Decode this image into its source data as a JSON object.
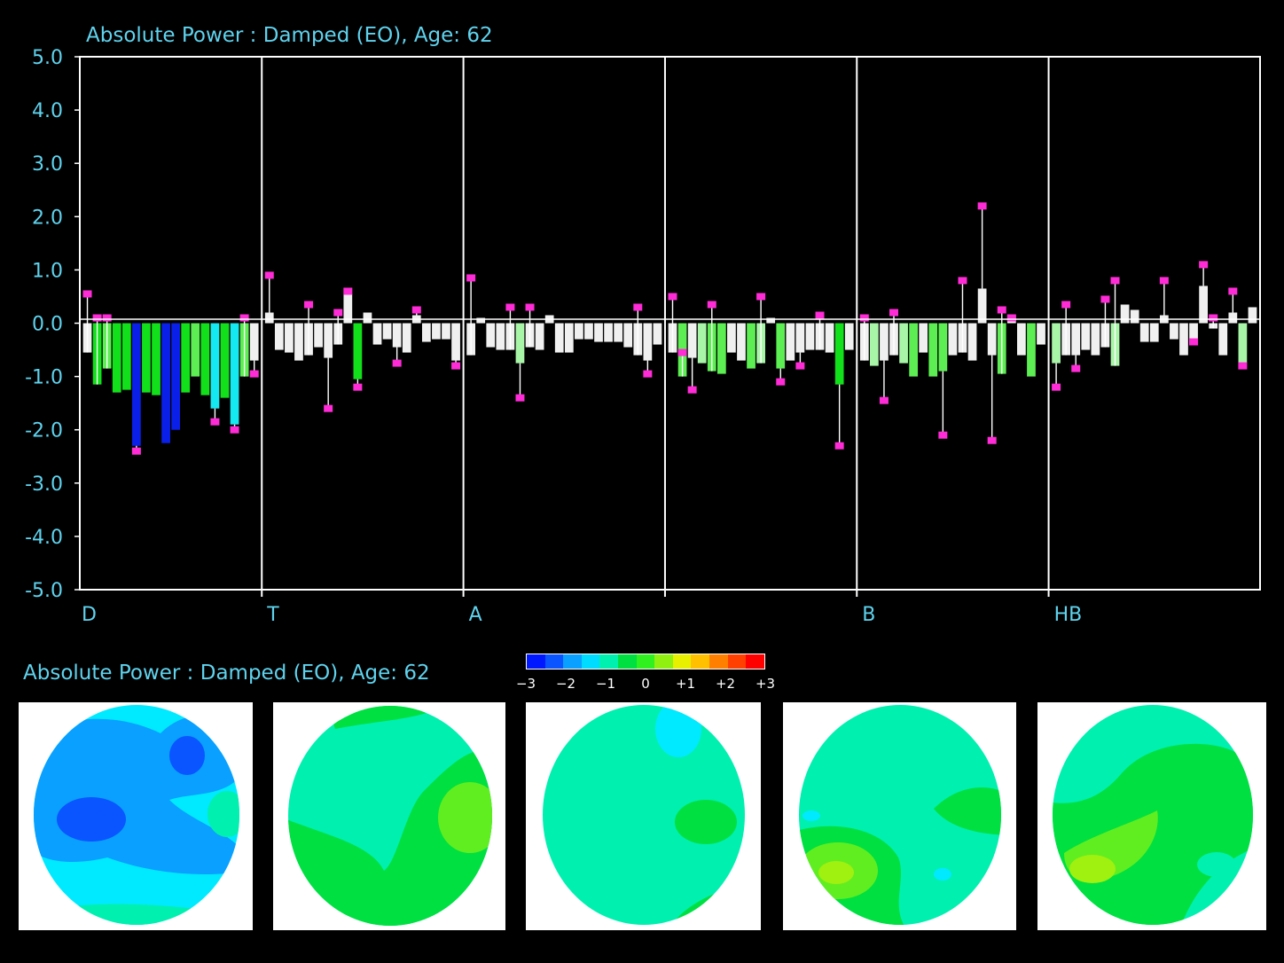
{
  "chart_data": {
    "type": "bar",
    "title": "Absolute Power : Damped (EO), Age: 62",
    "ylim": [
      -5.0,
      5.0
    ],
    "y_ticks": [
      "5.0",
      "4.0",
      "3.0",
      "2.0",
      "1.0",
      "0.0",
      "-1.0",
      "-2.0",
      "-3.0",
      "-4.0",
      "-5.0"
    ],
    "grid": "vertical band separators only",
    "bands": [
      {
        "label": "D",
        "values": [
          -0.55,
          -1.15,
          -0.85,
          -1.3,
          -1.25,
          -2.3,
          -1.3,
          -1.35,
          -2.25,
          -2.0,
          -1.3,
          -1.0,
          -1.35,
          -1.6,
          -1.4,
          -1.9,
          -1.0,
          -0.7
        ],
        "whiskers": [
          0.55,
          0.1,
          0.1,
          -1.3,
          -1.25,
          -2.4,
          -1.3,
          -1.35,
          -2.25,
          -2.0,
          -1.3,
          -1.0,
          -1.35,
          -1.85,
          -1.4,
          -2.0,
          0.1,
          -0.95
        ]
      },
      {
        "label": "T",
        "values": [
          0.2,
          -0.5,
          -0.55,
          -0.7,
          -0.6,
          -0.45,
          -0.65,
          -0.4,
          0.55,
          -1.05,
          0.2,
          -0.4,
          -0.3,
          -0.45,
          -0.55,
          0.15,
          -0.35,
          -0.3,
          -0.3,
          -0.7
        ],
        "whiskers": [
          0.9,
          -0.5,
          -0.55,
          -0.7,
          0.35,
          -0.45,
          -1.6,
          0.2,
          0.6,
          -1.2,
          0.2,
          -0.4,
          -0.3,
          -0.75,
          -0.55,
          0.25,
          -0.35,
          -0.3,
          -0.3,
          -0.8
        ]
      },
      {
        "label": "A",
        "values": [
          -0.6,
          0.1,
          -0.45,
          -0.5,
          -0.5,
          -0.75,
          -0.45,
          -0.5,
          0.15,
          -0.55,
          -0.55,
          -0.3,
          -0.3,
          -0.35,
          -0.35,
          -0.35,
          -0.45,
          -0.6,
          -0.7,
          -0.4
        ],
        "whiskers": [
          0.85,
          0.1,
          -0.45,
          -0.5,
          0.3,
          -1.4,
          0.3,
          -0.5,
          0.15,
          -0.55,
          -0.55,
          -0.3,
          -0.3,
          -0.35,
          -0.35,
          -0.35,
          -0.45,
          0.3,
          -0.95,
          -0.4
        ]
      },
      {
        "label": "",
        "values": [
          -0.55,
          -1.0,
          -0.65,
          -0.75,
          -0.9,
          -0.95,
          -0.55,
          -0.7,
          -0.85,
          -0.75,
          0.1,
          -0.85,
          -0.7,
          -0.55,
          -0.5,
          -0.5,
          -0.55,
          -1.15,
          -0.5
        ],
        "whiskers": [
          0.5,
          -0.55,
          -1.25,
          -0.75,
          0.35,
          -0.95,
          -0.55,
          -0.7,
          -0.85,
          0.5,
          0.1,
          -1.1,
          -0.7,
          -0.8,
          -0.5,
          0.15,
          -0.55,
          -2.3,
          -0.5
        ]
      },
      {
        "label": "B",
        "values": [
          -0.7,
          -0.8,
          -0.7,
          -0.6,
          -0.75,
          -1.0,
          -0.55,
          -1.0,
          -0.9,
          -0.6,
          -0.55,
          -0.7,
          0.65,
          -0.6,
          -0.95,
          0.15,
          -0.6,
          -1.0,
          -0.4
        ],
        "whiskers": [
          0.1,
          -0.8,
          -1.45,
          0.2,
          -0.75,
          -1.0,
          -0.55,
          -1.0,
          -2.1,
          -0.6,
          0.8,
          -0.7,
          2.2,
          -2.2,
          0.25,
          0.1,
          -0.6,
          -1.0,
          -0.4
        ]
      },
      {
        "label": "HB",
        "values": [
          -0.75,
          -0.6,
          -0.6,
          -0.5,
          -0.6,
          -0.45,
          -0.8,
          0.35,
          0.25,
          -0.35,
          -0.35,
          0.15,
          -0.3,
          -0.6,
          -0.4,
          0.7,
          -0.1,
          -0.6,
          0.2,
          -0.75,
          0.3
        ],
        "whiskers": [
          -1.2,
          0.35,
          -0.85,
          -0.5,
          -0.6,
          0.45,
          0.8,
          0.35,
          0.25,
          -0.35,
          -0.35,
          0.8,
          -0.3,
          -0.6,
          -0.35,
          1.1,
          0.1,
          -0.6,
          0.6,
          -0.8,
          0.3
        ]
      }
    ]
  },
  "maps": {
    "title": "Absolute Power : Damped (EO), Age: 62",
    "scale_labels": [
      "−3",
      "−2",
      "−1",
      "0",
      "+1",
      "+2",
      "+3"
    ],
    "scale_colors": [
      "#0018ff",
      "#0a55ff",
      "#0aa0ff",
      "#00dcff",
      "#00f0b0",
      "#00e040",
      "#30f020",
      "#90f010",
      "#e8f000",
      "#ffc000",
      "#ff8000",
      "#ff4000",
      "#ff0000"
    ]
  }
}
